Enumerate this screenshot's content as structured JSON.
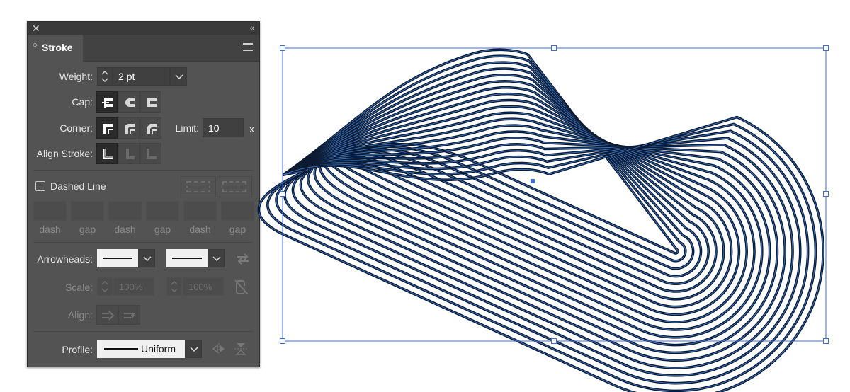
{
  "panel": {
    "close_glyph": "✕",
    "collapse_glyph": "‹‹",
    "tab_arrows": "◇",
    "tab_title": "Stroke",
    "weight": {
      "label": "Weight:",
      "value": "2 pt"
    },
    "cap": {
      "label": "Cap:",
      "options": [
        "butt-cap",
        "round-cap",
        "projecting-cap"
      ],
      "selected": "butt-cap"
    },
    "corner": {
      "label": "Corner:",
      "options": [
        "miter-join",
        "round-join",
        "bevel-join"
      ],
      "selected": "miter-join",
      "limit_label": "Limit:",
      "limit_value": "10",
      "limit_suffix": "x"
    },
    "align_stroke": {
      "label": "Align Stroke:",
      "options": [
        "align-center",
        "align-inside",
        "align-outside"
      ],
      "selected": "align-center"
    },
    "dashed_line": {
      "label": "Dashed Line",
      "checked": false
    },
    "dash_gap": {
      "labels": [
        "dash",
        "gap",
        "dash",
        "gap",
        "dash",
        "gap"
      ],
      "values": [
        "",
        "",
        "",
        "",
        "",
        ""
      ]
    },
    "arrowheads": {
      "label": "Arrowheads:"
    },
    "scale": {
      "label": "Scale:",
      "start": "100%",
      "end": "100%"
    },
    "align": {
      "label": "Align:"
    },
    "profile": {
      "label": "Profile:",
      "value": "Uniform"
    }
  },
  "colors": {
    "panel_bg": "#535353",
    "selection": "#3d6ee0",
    "stroke_outer": "#0d1b33",
    "stroke_inner": "#3a78c8"
  }
}
